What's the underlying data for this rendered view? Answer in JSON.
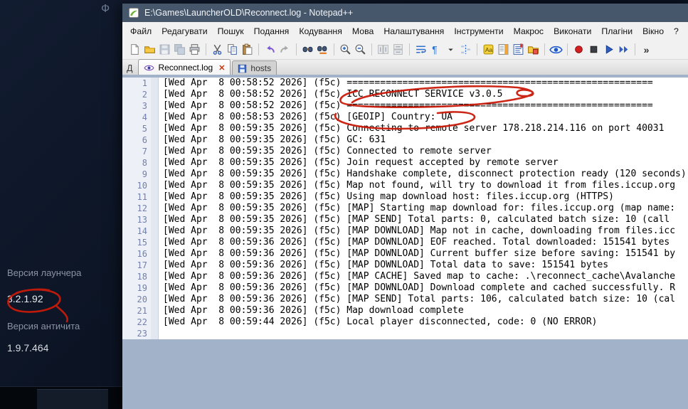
{
  "window": {
    "title": "E:\\Games\\LauncherOLD\\Reconnect.log - Notepad++"
  },
  "menu": {
    "items": [
      "Файл",
      "Редагувати",
      "Пошук",
      "Подання",
      "Кодування",
      "Мова",
      "Налаштування",
      "Інструменти",
      "Макрос",
      "Виконати",
      "Плагіни",
      "Вікно",
      "?"
    ]
  },
  "toolbar": {
    "icons": [
      "new-file",
      "open-folder",
      "save",
      "save-all",
      "print",
      "separator",
      "cut",
      "copy",
      "paste",
      "separator",
      "undo",
      "redo",
      "separator",
      "find",
      "replace",
      "separator",
      "zoom-in",
      "zoom-out",
      "separator",
      "sync-scroll-v",
      "sync-scroll-h",
      "separator",
      "word-wrap",
      "show-all-characters",
      "dropdown-arrow",
      "indent-guide",
      "separator",
      "define-language",
      "doc-map",
      "function-list",
      "folder-as-workspace",
      "separator",
      "monitoring-eye",
      "separator",
      "macro-record",
      "macro-stop",
      "macro-play",
      "macro-run-multiple",
      "separator",
      "overflow-chevron"
    ]
  },
  "tabs": {
    "leading_text": "Д",
    "items": [
      {
        "label": "Reconnect.log",
        "icon": "monitoring-eye-small",
        "active": true,
        "close_glyph": "✕"
      },
      {
        "label": "hosts",
        "icon": "saved-file",
        "active": false
      }
    ]
  },
  "editor": {
    "lines": [
      "[Wed Apr  8 00:58:52 2026] (f5c) =======================================================",
      "[Wed Apr  8 00:58:52 2026] (f5c) ICC RECONNECT SERVICE v3.0.5",
      "[Wed Apr  8 00:58:52 2026] (f5c) =======================================================",
      "[Wed Apr  8 00:58:53 2026] (f5c) [GEOIP] Country: UA",
      "[Wed Apr  8 00:59:35 2026] (f5c) Connecting to remote server 178.218.214.116 on port 40031",
      "[Wed Apr  8 00:59:35 2026] (f5c) GC: 631",
      "[Wed Apr  8 00:59:35 2026] (f5c) Connected to remote server",
      "[Wed Apr  8 00:59:35 2026] (f5c) Join request accepted by remote server",
      "[Wed Apr  8 00:59:35 2026] (f5c) Handshake complete, disconnect protection ready (120 seconds)",
      "[Wed Apr  8 00:59:35 2026] (f5c) Map not found, will try to download it from files.iccup.org",
      "[Wed Apr  8 00:59:35 2026] (f5c) Using map download host: files.iccup.org (HTTPS)",
      "[Wed Apr  8 00:59:35 2026] (f5c) [MAP] Starting map download for: files.iccup.org (map name:",
      "[Wed Apr  8 00:59:35 2026] (f5c) [MAP SEND] Total parts: 0, calculated batch size: 10 (call",
      "[Wed Apr  8 00:59:35 2026] (f5c) [MAP DOWNLOAD] Map not in cache, downloading from files.icc",
      "[Wed Apr  8 00:59:36 2026] (f5c) [MAP DOWNLOAD] EOF reached. Total downloaded: 151541 bytes",
      "[Wed Apr  8 00:59:36 2026] (f5c) [MAP DOWNLOAD] Current buffer size before saving: 151541 by",
      "[Wed Apr  8 00:59:36 2026] (f5c) [MAP DOWNLOAD] Total data to save: 151541 bytes",
      "[Wed Apr  8 00:59:36 2026] (f5c) [MAP CACHE] Saved map to cache: .\\reconnect_cache\\Avalanche",
      "[Wed Apr  8 00:59:36 2026] (f5c) [MAP DOWNLOAD] Download complete and cached successfully. R",
      "[Wed Apr  8 00:59:36 2026] (f5c) [MAP SEND] Total parts: 106, calculated batch size: 10 (cal",
      "[Wed Apr  8 00:59:36 2026] (f5c) Map download complete",
      "[Wed Apr  8 00:59:44 2026] (f5c) Local player disconnected, code: 0 (NO ERROR)",
      ""
    ]
  },
  "launcher": {
    "partial_glyph": "Ф",
    "launcher_version_label": "Версия лаунчера",
    "launcher_version": "3.2.1.92",
    "anticheat_version_label": "Версия античита",
    "anticheat_version": "1.9.7.464"
  },
  "colors": {
    "annotation": "#c81a0a",
    "titlebar": "#46566b",
    "editor_void": "#a2b2c9"
  }
}
